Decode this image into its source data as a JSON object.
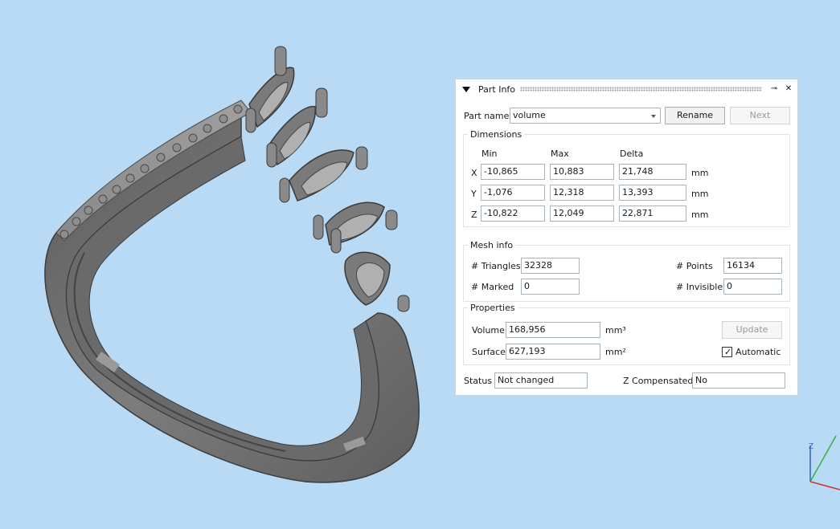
{
  "panel": {
    "title": "Part Info",
    "pin_icon": "pin-icon",
    "close_icon": "close-icon"
  },
  "part": {
    "name_label": "Part name",
    "name_value": "volume",
    "rename_label": "Rename",
    "next_label": "Next"
  },
  "dimensions": {
    "title": "Dimensions",
    "headers": [
      "Min",
      "Max",
      "Delta"
    ],
    "unit": "mm",
    "rows": [
      {
        "axis": "X",
        "min": "-10,865",
        "max": "10,883",
        "delta": "21,748"
      },
      {
        "axis": "Y",
        "min": "-1,076",
        "max": "12,318",
        "delta": "13,393"
      },
      {
        "axis": "Z",
        "min": "-10,822",
        "max": "12,049",
        "delta": "22,871"
      }
    ]
  },
  "mesh_info": {
    "title": "Mesh info",
    "triangles_label": "# Triangles",
    "triangles_value": "32328",
    "points_label": "# Points",
    "points_value": "16134",
    "marked_label": "# Marked",
    "marked_value": "0",
    "invisible_label": "# Invisible",
    "invisible_value": "0"
  },
  "properties": {
    "title": "Properties",
    "volume_label": "Volume",
    "volume_value": "168,956",
    "volume_unit": "mm³",
    "surface_label": "Surface",
    "surface_value": "627,193",
    "surface_unit": "mm²",
    "update_label": "Update",
    "automatic_label": "Automatic",
    "automatic_checked": true
  },
  "status": {
    "label": "Status",
    "value": "Not changed",
    "z_comp_label": "Z Compensated",
    "z_comp_value": "No"
  },
  "axis_gizmo": {
    "z_label": "Z"
  },
  "colors": {
    "viewport_bg": "#b8daf5",
    "model": "#6f6f6f"
  }
}
